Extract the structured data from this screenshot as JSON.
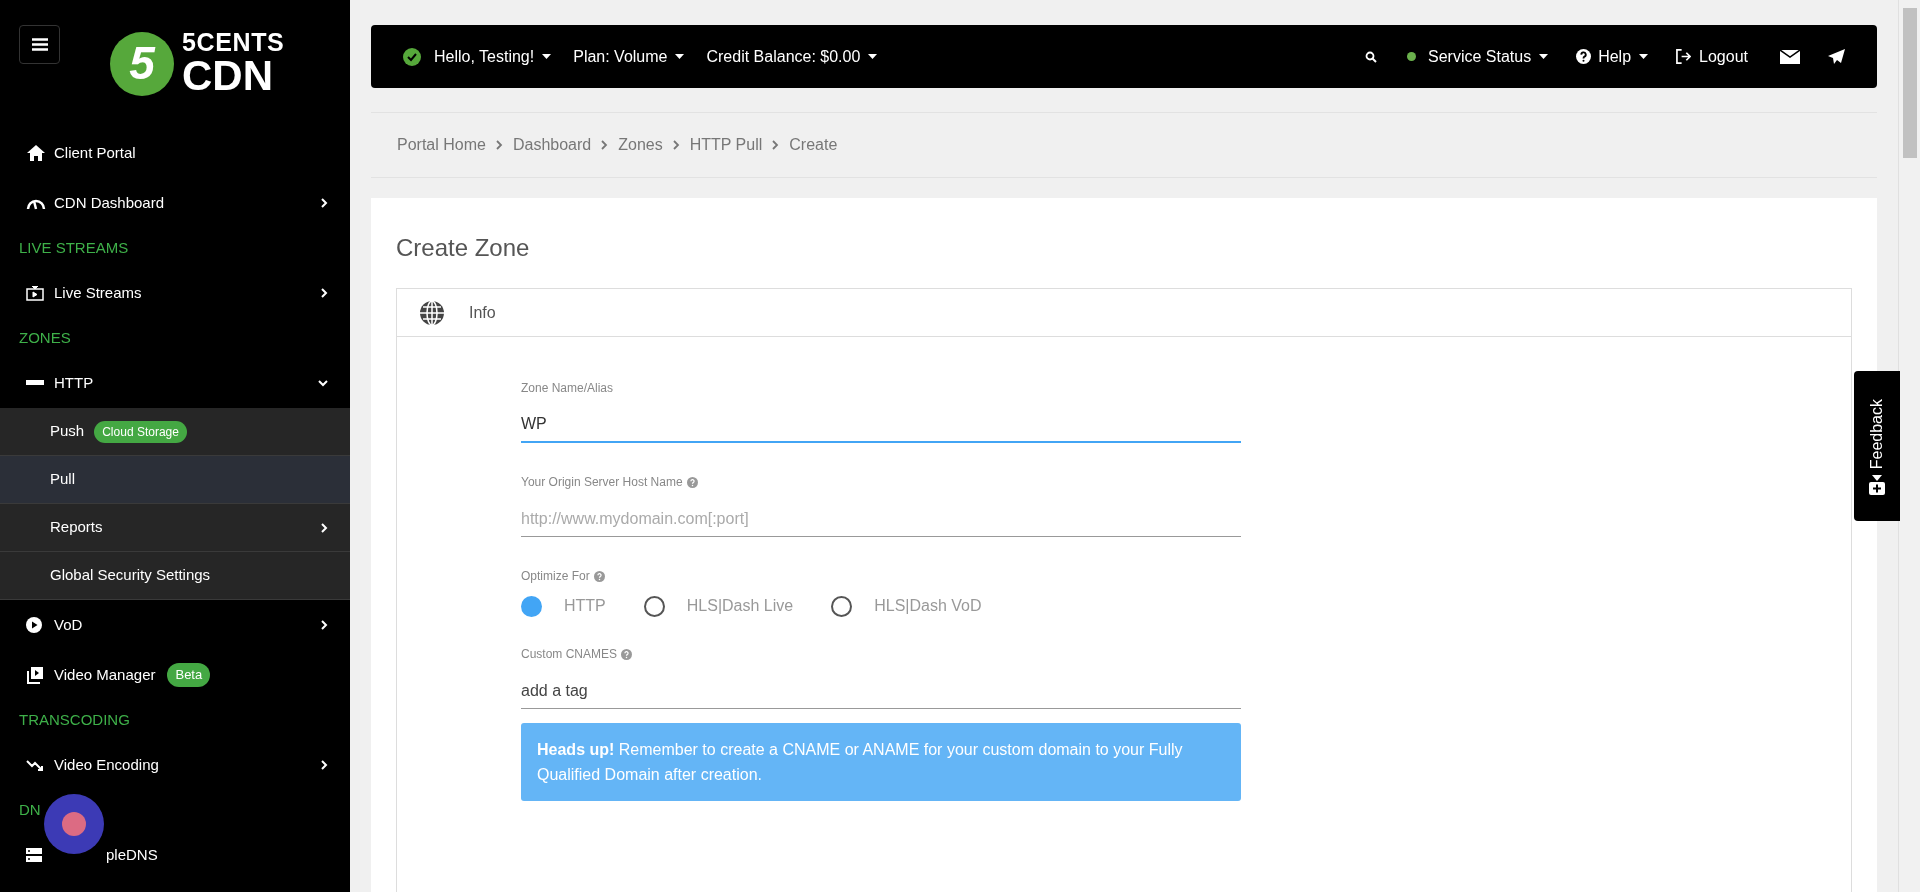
{
  "sidebar": {
    "logo": {
      "mark": "5",
      "line1": "5CENTS",
      "line2": "CDN"
    },
    "items": [
      {
        "kind": "item",
        "label": "Client Portal"
      },
      {
        "kind": "item",
        "label": "CDN Dashboard",
        "expanded": false
      },
      {
        "kind": "heading",
        "label": "LIVE STREAMS"
      },
      {
        "kind": "item",
        "label": "Live Streams",
        "expanded": false
      },
      {
        "kind": "heading",
        "label": "ZONES"
      },
      {
        "kind": "item",
        "label": "HTTP",
        "expanded": true
      },
      {
        "kind": "subitem",
        "label": "Push",
        "badge": "Cloud Storage",
        "selected": false
      },
      {
        "kind": "subitem",
        "label": "Pull",
        "selected": true
      },
      {
        "kind": "subitem",
        "label": "Reports",
        "expanded": false,
        "selected": false
      },
      {
        "kind": "subitem",
        "label": "Global Security Settings",
        "selected": false
      },
      {
        "kind": "item",
        "label": "VoD",
        "expanded": false
      },
      {
        "kind": "item",
        "label": "Video Manager",
        "badge": "Beta"
      },
      {
        "kind": "heading",
        "label": "TRANSCODING"
      },
      {
        "kind": "item",
        "label": "Video Encoding",
        "expanded": false
      },
      {
        "kind": "heading",
        "label": "DN"
      },
      {
        "kind": "item",
        "label": "pleDNS"
      }
    ]
  },
  "topbar": {
    "left": [
      {
        "label": "Hello, Testing!"
      },
      {
        "label": "Plan: Volume"
      },
      {
        "label": "Credit Balance: $0.00"
      }
    ],
    "status": {
      "label": "Service Status",
      "color": "#6ab04c"
    },
    "help": "Help",
    "logout": "Logout"
  },
  "breadcrumb": [
    "Portal Home",
    "Dashboard",
    "Zones",
    "HTTP Pull",
    "Create"
  ],
  "form": {
    "title": "Create Zone",
    "section": "Info",
    "fields": [
      {
        "kind": "text",
        "label": "Zone Name/Alias",
        "value": "WP",
        "focused": true
      },
      {
        "kind": "text",
        "label": "Your Origin Server Host Name",
        "help": true,
        "placeholder": "http://www.mydomain.com[:port]",
        "focused": false
      },
      {
        "kind": "radio",
        "label": "Optimize For",
        "help": true,
        "options": [
          {
            "label": "HTTP",
            "selected": true
          },
          {
            "label": "HLS|Dash Live",
            "selected": false
          },
          {
            "label": "HLS|Dash VoD",
            "selected": false
          }
        ]
      },
      {
        "kind": "tags",
        "label": "Custom CNAMES",
        "help": true,
        "placeholder": "add a tag"
      }
    ],
    "alert": "**Heads up!** Remember to create a CNAME or ANAME for your custom domain to your Fully Qualified Domain after creation."
  },
  "feedback": "Feedback"
}
